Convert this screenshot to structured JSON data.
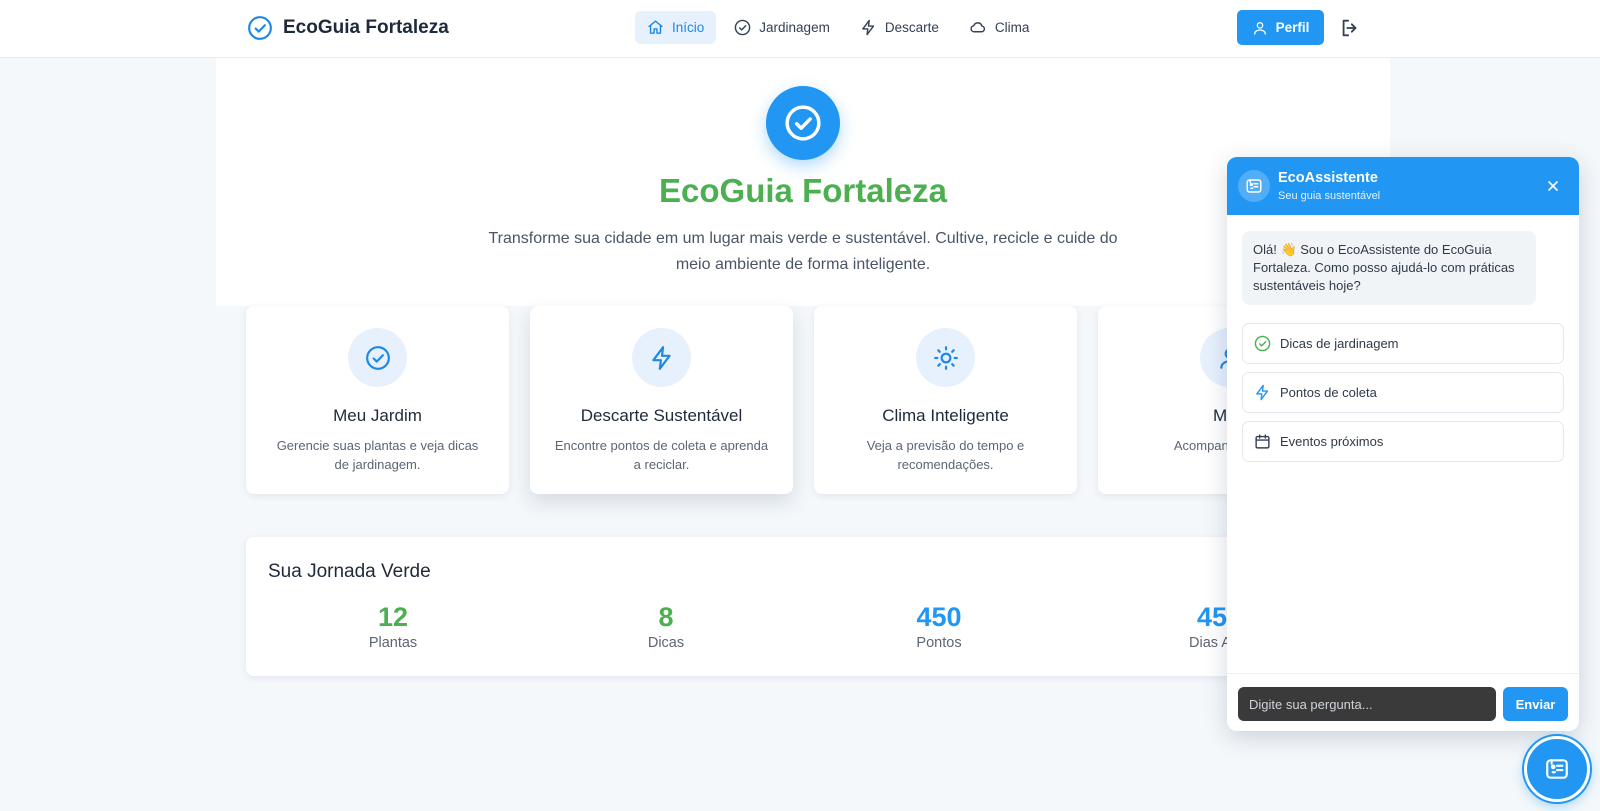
{
  "colors": {
    "primary": "#2196f3",
    "green": "#4caf50",
    "background": "#f4f8fb"
  },
  "navbar": {
    "brand": {
      "icon": "check-circle-icon",
      "title": "EcoGuia Fortaleza"
    },
    "links": [
      {
        "label": "Início",
        "icon": "home-icon",
        "active": true
      },
      {
        "label": "Jardinagem",
        "icon": "check-circle-icon"
      },
      {
        "label": "Descarte",
        "icon": "lightning-icon"
      },
      {
        "label": "Clima",
        "icon": "cloud-icon"
      }
    ],
    "profile_label": "Perfil",
    "logout_icon": "logout-icon"
  },
  "hero": {
    "title": "EcoGuia Fortaleza",
    "subtitle": "Transforme sua cidade em um lugar mais verde e sustentável. Cultive, recicle e cuide do meio ambiente de forma inteligente."
  },
  "features": [
    {
      "title": "Meu Jardim",
      "desc": "Gerencie suas plantas e veja dicas de jardinagem.",
      "icon": "check-circle-icon"
    },
    {
      "title": "Descarte Sustentável",
      "desc": "Encontre pontos de coleta e aprenda a reciclar.",
      "icon": "lightning-icon"
    },
    {
      "title": "Clima Inteligente",
      "desc": "Veja a previsão do tempo e recomendações.",
      "icon": "sun-icon"
    },
    {
      "title": "Meu",
      "desc": "Acompanhe s conq",
      "icon": "user-icon"
    }
  ],
  "stats": {
    "title": "Sua Jornada Verde",
    "items": [
      {
        "value": "12",
        "label": "Plantas",
        "color": "#4caf50"
      },
      {
        "value": "8",
        "label": "Dicas",
        "color": "#4caf50"
      },
      {
        "value": "450",
        "label": "Pontos",
        "color": "#2196f3"
      },
      {
        "value": "45",
        "label": "Dias At",
        "color": "#2196f3"
      }
    ]
  },
  "chat": {
    "name": "EcoAssistente",
    "tagline": "Seu guia sustentável",
    "greeting": "Olá! 👋 Sou o EcoAssistente do EcoGuia Fortaleza. Como posso ajudá-lo com práticas sustentáveis hoje?",
    "quick_actions": [
      {
        "label": "Dicas de jardinagem",
        "icon": "check-circle-icon"
      },
      {
        "label": "Pontos de coleta",
        "icon": "lightning-icon"
      },
      {
        "label": "Eventos próximos",
        "icon": "calendar-icon"
      }
    ],
    "input_placeholder": "Digite sua pergunta...",
    "send_label": "Enviar"
  }
}
